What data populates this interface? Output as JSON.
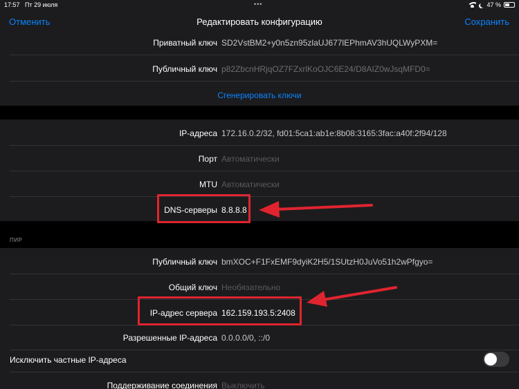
{
  "status_bar": {
    "time": "17:57",
    "date": "Пт 29 июля",
    "battery": "47 %",
    "battery_level": 0.47
  },
  "nav": {
    "cancel": "Отменить",
    "title": "Редактировать конфигурацию",
    "save": "Сохранить"
  },
  "interface": {
    "private_key": {
      "label": "Приватный ключ",
      "value": "SD2VstBM2+y0n5zn95zlaUJ677lEPhmAV3hUQLWyPXM="
    },
    "public_key": {
      "label": "Публичный ключ",
      "value": "p82ZbcnHRjqOZ7FZxrlKoOJC6E24/D8AIZ0wJsqMFD0="
    },
    "generate_keys": "Сгенерировать ключи",
    "addresses": {
      "label": "IP-адреса",
      "value": "172.16.0.2/32, fd01:5ca1:ab1e:8b08:3165:3fac:a40f:2f94/128"
    },
    "port": {
      "label": "Порт",
      "placeholder": "Автоматически"
    },
    "mtu": {
      "label": "MTU",
      "placeholder": "Автоматически"
    },
    "dns": {
      "label": "DNS-серверы",
      "value": "8.8.8.8"
    }
  },
  "peer": {
    "header": "ПИР",
    "public_key": {
      "label": "Публичный ключ",
      "value": "bmXOC+F1FxEMF9dyiK2H5/1SUtzH0JuVo51h2wPfgyo="
    },
    "preshared_key": {
      "label": "Общий ключ",
      "placeholder": "Необязательно"
    },
    "endpoint": {
      "label": "IP-адрес сервера",
      "value": "162.159.193.5:2408"
    },
    "allowed_ips": {
      "label": "Разрешенные IP-адреса",
      "value": "0.0.0.0/0, ::/0"
    },
    "exclude_private": {
      "label": "Исключить частные IP-адреса",
      "on": false
    },
    "keepalive": {
      "label": "Поддерживание соединения",
      "placeholder": "Выключить"
    }
  },
  "colors": {
    "accent": "#0a84ff",
    "highlight": "#e0242f"
  }
}
